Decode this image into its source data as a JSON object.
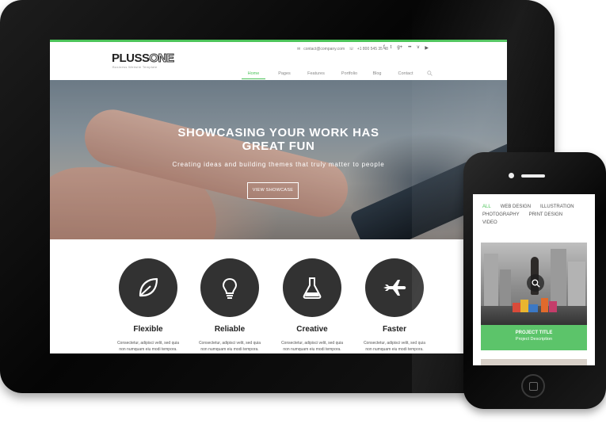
{
  "tablet": {
    "logo": {
      "part1": "PLUSS",
      "part2": "ONE",
      "tagline": "Business Website Template"
    },
    "contact": {
      "email": "contact@company.com",
      "phone": "+1 800 545 35 48"
    },
    "social_icons": [
      "facebook-icon",
      "twitter-icon",
      "google-plus-icon",
      "flickr-icon",
      "vimeo-icon",
      "youtube-icon"
    ],
    "social_glyphs": [
      "f",
      "t",
      "g+",
      "••",
      "v",
      "▶"
    ],
    "nav": [
      {
        "label": "Home",
        "active": true
      },
      {
        "label": "Pages"
      },
      {
        "label": "Features"
      },
      {
        "label": "Portfolio"
      },
      {
        "label": "Blog"
      },
      {
        "label": "Contact"
      }
    ],
    "hero": {
      "title_line1": "SHOWCASING YOUR WORK HAS",
      "title_line2": "GREAT FUN",
      "subtitle": "Creating ideas and building themes that truly matter to people",
      "button": "VIEW SHOWCASE"
    },
    "features": [
      {
        "title": "Flexible",
        "text1": "Consectetur, adipisci velit, sed quia",
        "text2": "non numquam eiu modi tempora."
      },
      {
        "title": "Reliable",
        "text1": "Consectetur, adipisci velit, sed quia",
        "text2": "non numquam eiu modi tempora."
      },
      {
        "title": "Creative",
        "text1": "Consectetur, adipisci velit, sed quia",
        "text2": "non numquam eiu modi tempora."
      },
      {
        "title": "Faster",
        "text1": "Consectetur, adipisci velit, sed quia",
        "text2": "non numquam eiu modi tempora."
      }
    ]
  },
  "phone": {
    "filters": [
      {
        "label": "ALL",
        "active": true
      },
      {
        "label": "WEB DESIGN"
      },
      {
        "label": "ILLUSTRATION"
      },
      {
        "label": "PHOTOGRAPHY"
      },
      {
        "label": "PRINT DESIGN"
      },
      {
        "label": "VIDEO"
      }
    ],
    "project": {
      "title": "PROJECT TITLE",
      "description": "Project Description"
    }
  },
  "colors": {
    "accent": "#4cc35a",
    "dark_circle": "#323232",
    "device_body": "#0a0a0a"
  }
}
